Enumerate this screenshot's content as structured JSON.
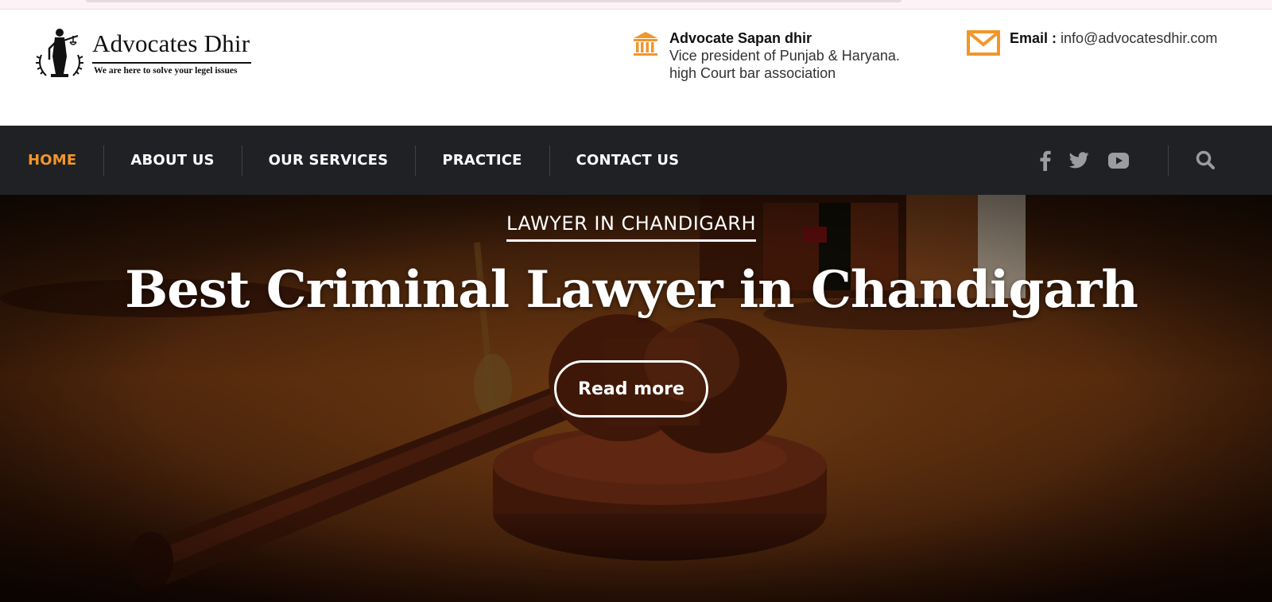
{
  "site": {
    "logo_name": "Advocates Dhir",
    "logo_tagline": "We are here to solve your legel issues"
  },
  "header": {
    "advocate": {
      "name": "Advocate Sapan dhir",
      "line1": "Vice president of Punjab & Haryana.",
      "line2": "high Court bar association",
      "icon": "courthouse-icon"
    },
    "email": {
      "label": "Email :",
      "value": "info@advocatesdhir.com",
      "icon": "envelope-icon"
    }
  },
  "nav": {
    "items": [
      {
        "label": "HOME",
        "active": true
      },
      {
        "label": "ABOUT US",
        "active": false
      },
      {
        "label": "OUR SERVICES",
        "active": false
      },
      {
        "label": "PRACTICE",
        "active": false
      },
      {
        "label": "CONTACT US",
        "active": false
      }
    ],
    "social": [
      "facebook-icon",
      "twitter-icon",
      "youtube-icon"
    ],
    "search_icon": "search-icon"
  },
  "hero": {
    "kicker": "LAWYER IN CHANDIGARH",
    "title": "Best Criminal Lawyer in Chandigarh",
    "cta": "Read more"
  },
  "colors": {
    "accent": "#f2962b",
    "nav_bg": "#1f2124",
    "text_dark": "#111111"
  }
}
